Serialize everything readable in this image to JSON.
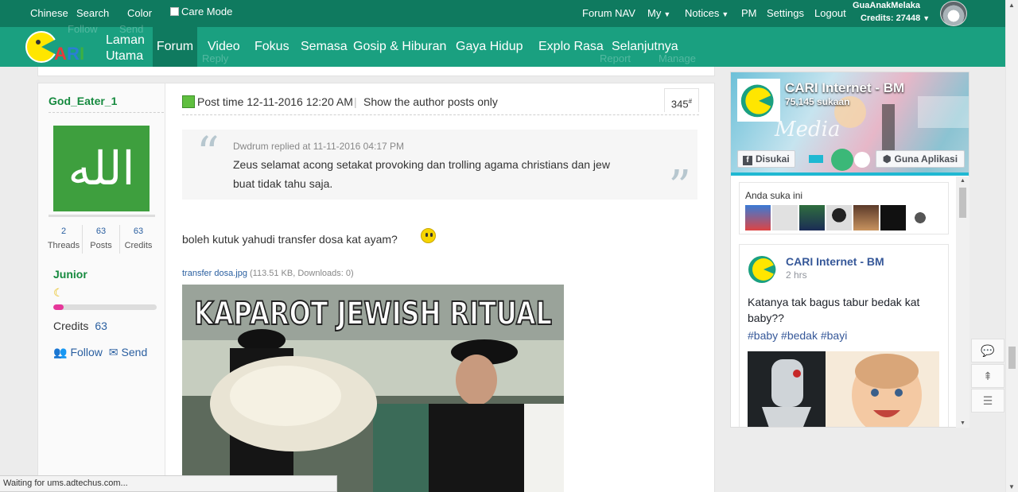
{
  "topbar": {
    "chinese": "Chinese",
    "search": "Search",
    "color": "Color",
    "care_mode": "Care Mode",
    "forum_nav": "Forum NAV",
    "my": "My",
    "notices": "Notices",
    "pm": "PM",
    "settings": "Settings",
    "logout": "Logout",
    "username": "GuaAnakMelaka",
    "credits": "Credits: 27448"
  },
  "nav": {
    "home_line1": "Laman",
    "home_line2": "Utama",
    "items": [
      "Forum",
      "Video",
      "Fokus",
      "Semasa",
      "Gosip & Hiburan",
      "Gaya Hidup",
      "Explo Rasa",
      "Selanjutnya"
    ]
  },
  "ghost": {
    "follow": "Follow",
    "send": "Send",
    "reply": "Reply",
    "report": "Report",
    "manage": "Manage"
  },
  "author": {
    "name": "God_Eater_1",
    "threads_value": "2",
    "threads_label": "Threads",
    "posts_value": "63",
    "posts_label": "Posts",
    "credits_value": "63",
    "credits_label": "Credits",
    "rank": "Junior",
    "rank_progress_percent": 10,
    "credits_row_label": "Credits",
    "credits_row_value": "63",
    "follow": "Follow",
    "send": "Send"
  },
  "post": {
    "post_time": "Post time 12-11-2016 12:20 AM",
    "separator": "|",
    "author_only": "Show the author posts only",
    "floor": "345",
    "floor_mark": "#",
    "quote_meta": "Dwdrum replied at 11-11-2016 04:17 PM",
    "quote_text": "Zeus selamat acong setakat provoking dan trolling agama christians dan jew buat tidak tahu saja.",
    "message": "boleh kutuk yahudi transfer dosa kat ayam?",
    "attachment_name": "transfer dosa.jpg",
    "attachment_meta": "(113.51 KB, Downloads: 0)",
    "image_caption": "KAPAROT  JEWISH RITUAL"
  },
  "facebook": {
    "page_name": "CARI Internet - BM",
    "fans": "75,145 sukaan",
    "liked_button": "Disukai",
    "app_button": "Guna Aplikasi",
    "friends_label": "Anda suka ini",
    "post_name": "CARI Internet - BM",
    "post_time": "2 hrs",
    "post_text": "Katanya tak bagus tabur bedak kat baby??",
    "post_tags": "#baby #bedak #bayi"
  },
  "status_bar": "Waiting for ums.adtechus.com...",
  "colors": {
    "topbar": "#0f7a5f",
    "navbar": "#1aa080",
    "link": "#2a5fa0",
    "author_green": "#168a3f"
  }
}
